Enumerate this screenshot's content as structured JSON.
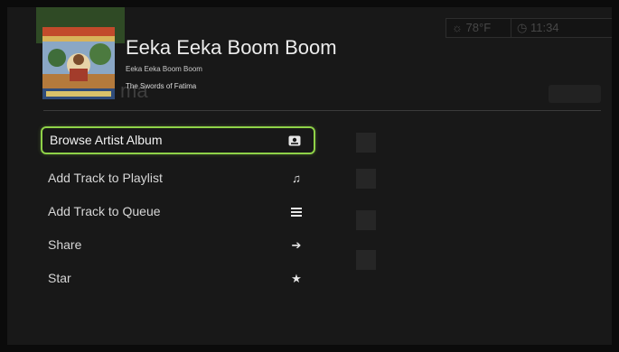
{
  "header": {
    "title": "Eeka Eeka Boom Boom",
    "album": "Eeka Eeka Boom Boom",
    "artist": "The Swords of Fatima"
  },
  "status": {
    "weather": "78°F",
    "clock": "11:34"
  },
  "menu": {
    "items": [
      {
        "label": "Browse Artist Album",
        "icon": "album-icon",
        "selected": true
      },
      {
        "label": "Add Track to Playlist",
        "icon": "music-note-icon",
        "selected": false
      },
      {
        "label": "Add Track to Queue",
        "icon": "queue-list-icon",
        "selected": false
      },
      {
        "label": "Share",
        "icon": "arrow-right-icon",
        "selected": false
      },
      {
        "label": "Star",
        "icon": "star-icon",
        "selected": false
      }
    ]
  },
  "colors": {
    "focus_border": "#8fd248",
    "background": "#181818",
    "text": "#e8e8e8"
  }
}
